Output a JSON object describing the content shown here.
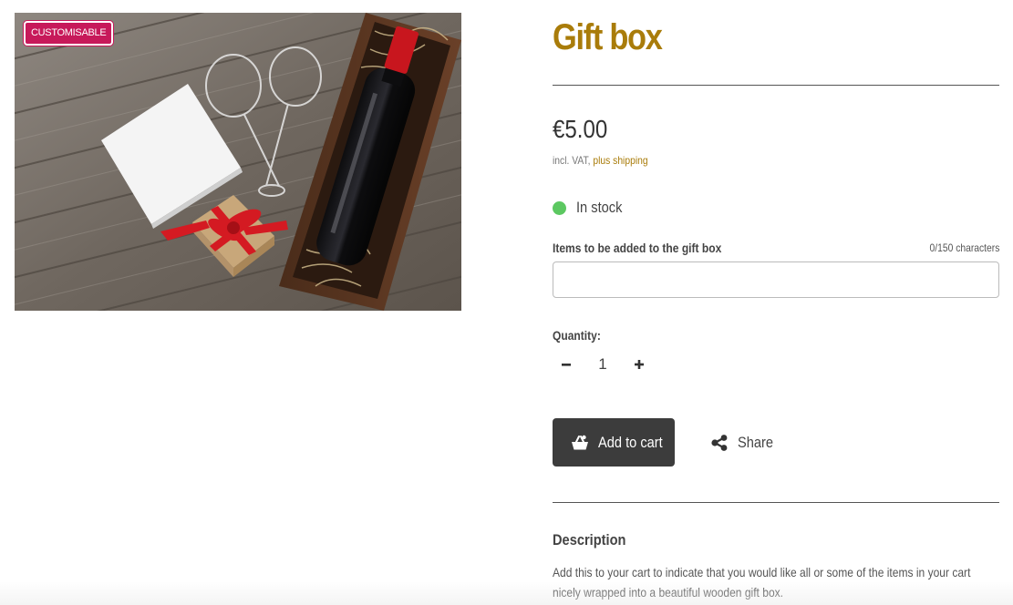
{
  "product_image": {
    "alt": "Wine bottle in wooden gift box with wine glasses, blank card and red-ribboned present",
    "badge": "CUSTOMISABLE"
  },
  "product": {
    "title": "Gift box",
    "price": "€5.00",
    "vat_prefix": "incl. VAT,",
    "shipping_link": "plus shipping",
    "stock_status": "In stock",
    "stock_color": "#5cc861",
    "accent_color": "#a97c0a",
    "badge_color": "#c7195a"
  },
  "customization": {
    "label": "Items to be added to the gift box",
    "char_count": "0/150 characters",
    "value": ""
  },
  "quantity": {
    "label": "Quantity:",
    "value": "1",
    "decrease_icon": "minus-icon",
    "increase_icon": "plus-icon"
  },
  "actions": {
    "add_to_cart": "Add to cart",
    "add_to_cart_icon": "basket-icon",
    "share": "Share",
    "share_icon": "share-icon"
  },
  "description": {
    "heading": "Description",
    "text": "Add this to your cart to indicate that you would like all or some of the items in your cart nicely wrapped into a beautiful wooden gift box."
  }
}
